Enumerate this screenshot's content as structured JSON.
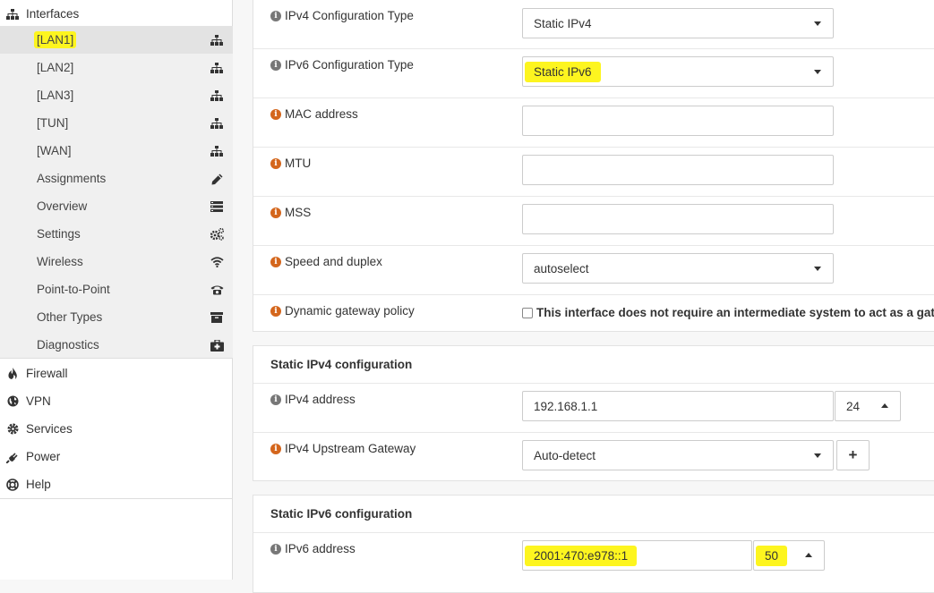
{
  "sidebar": {
    "interfaces_label": "Interfaces",
    "sub_items": [
      {
        "label": "[LAN1]",
        "icon": "sitemap-icon"
      },
      {
        "label": "[LAN2]",
        "icon": "sitemap-icon"
      },
      {
        "label": "[LAN3]",
        "icon": "sitemap-icon"
      },
      {
        "label": "[TUN]",
        "icon": "sitemap-icon"
      },
      {
        "label": "[WAN]",
        "icon": "sitemap-icon"
      },
      {
        "label": "Assignments",
        "icon": "pencil-icon"
      },
      {
        "label": "Overview",
        "icon": "list-icon"
      },
      {
        "label": "Settings",
        "icon": "gears-icon"
      },
      {
        "label": "Wireless",
        "icon": "wifi-icon"
      },
      {
        "label": "Point-to-Point",
        "icon": "phone-icon"
      },
      {
        "label": "Other Types",
        "icon": "archive-icon"
      },
      {
        "label": "Diagnostics",
        "icon": "medkit-icon"
      }
    ],
    "top_items": [
      {
        "label": "Firewall",
        "icon": "fire-icon"
      },
      {
        "label": "VPN",
        "icon": "globe-icon"
      },
      {
        "label": "Services",
        "icon": "cog-icon"
      },
      {
        "label": "Power",
        "icon": "plug-icon"
      },
      {
        "label": "Help",
        "icon": "lifebuoy-icon"
      }
    ]
  },
  "general": {
    "ipv4_type_label": "IPv4 Configuration Type",
    "ipv4_type_value": "Static IPv4",
    "ipv6_type_label": "IPv6 Configuration Type",
    "ipv6_type_value": "Static IPv6",
    "mac_label": "MAC address",
    "mac_value": "",
    "mtu_label": "MTU",
    "mtu_value": "",
    "mss_label": "MSS",
    "mss_value": "",
    "speed_label": "Speed and duplex",
    "speed_value": "autoselect",
    "gw_policy_label": "Dynamic gateway policy",
    "gw_policy_checkbox": "This interface does not require an intermediate system to act as a gateway"
  },
  "static_ipv4": {
    "title": "Static IPv4 configuration",
    "address_label": "IPv4 address",
    "address_value": "192.168.1.1",
    "prefix_value": "24",
    "gateway_label": "IPv4 Upstream Gateway",
    "gateway_value": "Auto-detect",
    "add_label": "+"
  },
  "static_ipv6": {
    "title": "Static IPv6 configuration",
    "address_label": "IPv6 address",
    "address_value": "2001:470:e978::1",
    "prefix_value": "50"
  },
  "colors": {
    "highlight": "#fdf51f",
    "info_orange": "#d4661c",
    "info_grey": "#777777"
  }
}
